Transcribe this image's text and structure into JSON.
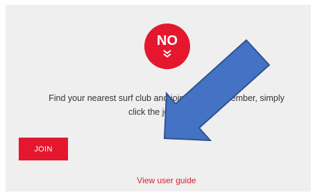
{
  "badge": {
    "label": "NO",
    "icon": "double-chevron-down-icon"
  },
  "message": {
    "line1": "Find your nearest surf club and join now as a member, simply",
    "line2": "click the join button."
  },
  "join_button": {
    "label": "JOIN"
  },
  "guide_link": {
    "label": "View user guide"
  },
  "overlay": {
    "icon": "arrow-pointing-down-left-icon"
  },
  "colors": {
    "accent_red": "#e5172f",
    "link_red": "#d42030",
    "panel_background": "#efefef",
    "arrow_fill": "#4472c4",
    "arrow_stroke": "#2f528f"
  }
}
